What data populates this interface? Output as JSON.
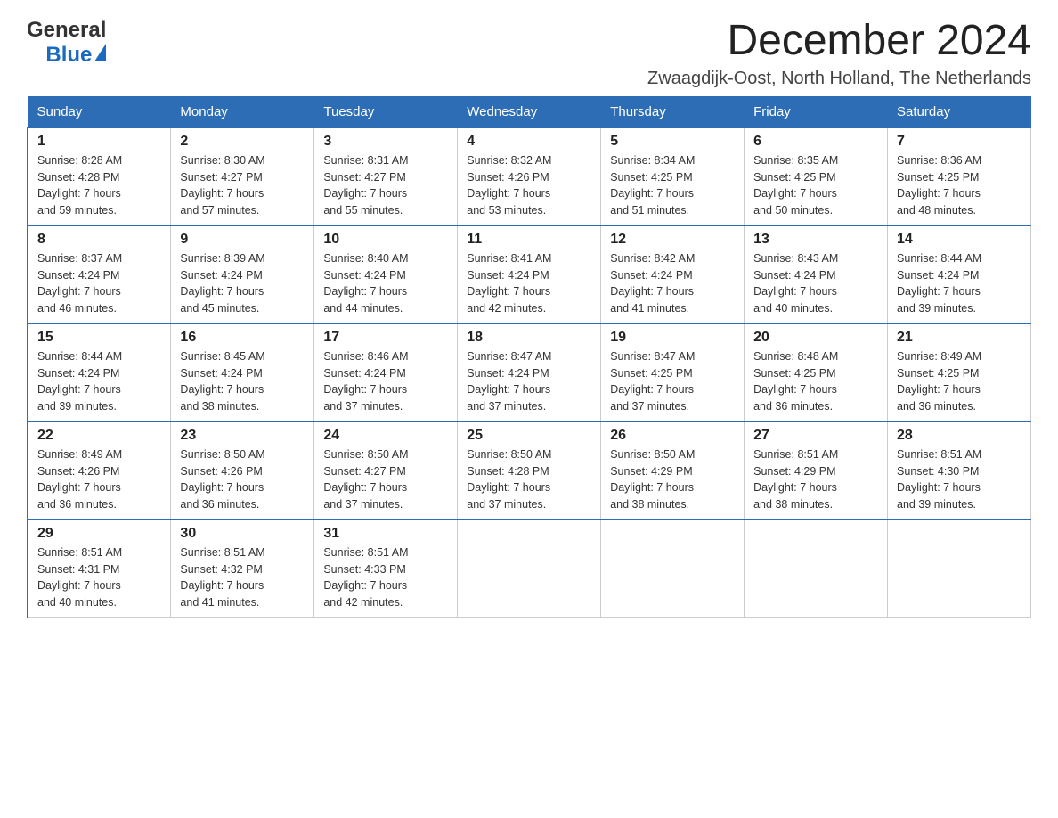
{
  "header": {
    "logo_general": "General",
    "logo_blue": "Blue",
    "month_title": "December 2024",
    "location": "Zwaagdijk-Oost, North Holland, The Netherlands"
  },
  "days_of_week": [
    "Sunday",
    "Monday",
    "Tuesday",
    "Wednesday",
    "Thursday",
    "Friday",
    "Saturday"
  ],
  "weeks": [
    [
      {
        "day": "1",
        "sunrise": "8:28 AM",
        "sunset": "4:28 PM",
        "daylight": "7 hours and 59 minutes."
      },
      {
        "day": "2",
        "sunrise": "8:30 AM",
        "sunset": "4:27 PM",
        "daylight": "7 hours and 57 minutes."
      },
      {
        "day": "3",
        "sunrise": "8:31 AM",
        "sunset": "4:27 PM",
        "daylight": "7 hours and 55 minutes."
      },
      {
        "day": "4",
        "sunrise": "8:32 AM",
        "sunset": "4:26 PM",
        "daylight": "7 hours and 53 minutes."
      },
      {
        "day": "5",
        "sunrise": "8:34 AM",
        "sunset": "4:25 PM",
        "daylight": "7 hours and 51 minutes."
      },
      {
        "day": "6",
        "sunrise": "8:35 AM",
        "sunset": "4:25 PM",
        "daylight": "7 hours and 50 minutes."
      },
      {
        "day": "7",
        "sunrise": "8:36 AM",
        "sunset": "4:25 PM",
        "daylight": "7 hours and 48 minutes."
      }
    ],
    [
      {
        "day": "8",
        "sunrise": "8:37 AM",
        "sunset": "4:24 PM",
        "daylight": "7 hours and 46 minutes."
      },
      {
        "day": "9",
        "sunrise": "8:39 AM",
        "sunset": "4:24 PM",
        "daylight": "7 hours and 45 minutes."
      },
      {
        "day": "10",
        "sunrise": "8:40 AM",
        "sunset": "4:24 PM",
        "daylight": "7 hours and 44 minutes."
      },
      {
        "day": "11",
        "sunrise": "8:41 AM",
        "sunset": "4:24 PM",
        "daylight": "7 hours and 42 minutes."
      },
      {
        "day": "12",
        "sunrise": "8:42 AM",
        "sunset": "4:24 PM",
        "daylight": "7 hours and 41 minutes."
      },
      {
        "day": "13",
        "sunrise": "8:43 AM",
        "sunset": "4:24 PM",
        "daylight": "7 hours and 40 minutes."
      },
      {
        "day": "14",
        "sunrise": "8:44 AM",
        "sunset": "4:24 PM",
        "daylight": "7 hours and 39 minutes."
      }
    ],
    [
      {
        "day": "15",
        "sunrise": "8:44 AM",
        "sunset": "4:24 PM",
        "daylight": "7 hours and 39 minutes."
      },
      {
        "day": "16",
        "sunrise": "8:45 AM",
        "sunset": "4:24 PM",
        "daylight": "7 hours and 38 minutes."
      },
      {
        "day": "17",
        "sunrise": "8:46 AM",
        "sunset": "4:24 PM",
        "daylight": "7 hours and 37 minutes."
      },
      {
        "day": "18",
        "sunrise": "8:47 AM",
        "sunset": "4:24 PM",
        "daylight": "7 hours and 37 minutes."
      },
      {
        "day": "19",
        "sunrise": "8:47 AM",
        "sunset": "4:25 PM",
        "daylight": "7 hours and 37 minutes."
      },
      {
        "day": "20",
        "sunrise": "8:48 AM",
        "sunset": "4:25 PM",
        "daylight": "7 hours and 36 minutes."
      },
      {
        "day": "21",
        "sunrise": "8:49 AM",
        "sunset": "4:25 PM",
        "daylight": "7 hours and 36 minutes."
      }
    ],
    [
      {
        "day": "22",
        "sunrise": "8:49 AM",
        "sunset": "4:26 PM",
        "daylight": "7 hours and 36 minutes."
      },
      {
        "day": "23",
        "sunrise": "8:50 AM",
        "sunset": "4:26 PM",
        "daylight": "7 hours and 36 minutes."
      },
      {
        "day": "24",
        "sunrise": "8:50 AM",
        "sunset": "4:27 PM",
        "daylight": "7 hours and 37 minutes."
      },
      {
        "day": "25",
        "sunrise": "8:50 AM",
        "sunset": "4:28 PM",
        "daylight": "7 hours and 37 minutes."
      },
      {
        "day": "26",
        "sunrise": "8:50 AM",
        "sunset": "4:29 PM",
        "daylight": "7 hours and 38 minutes."
      },
      {
        "day": "27",
        "sunrise": "8:51 AM",
        "sunset": "4:29 PM",
        "daylight": "7 hours and 38 minutes."
      },
      {
        "day": "28",
        "sunrise": "8:51 AM",
        "sunset": "4:30 PM",
        "daylight": "7 hours and 39 minutes."
      }
    ],
    [
      {
        "day": "29",
        "sunrise": "8:51 AM",
        "sunset": "4:31 PM",
        "daylight": "7 hours and 40 minutes."
      },
      {
        "day": "30",
        "sunrise": "8:51 AM",
        "sunset": "4:32 PM",
        "daylight": "7 hours and 41 minutes."
      },
      {
        "day": "31",
        "sunrise": "8:51 AM",
        "sunset": "4:33 PM",
        "daylight": "7 hours and 42 minutes."
      },
      null,
      null,
      null,
      null
    ]
  ],
  "labels": {
    "sunrise": "Sunrise:",
    "sunset": "Sunset:",
    "daylight": "Daylight:"
  }
}
